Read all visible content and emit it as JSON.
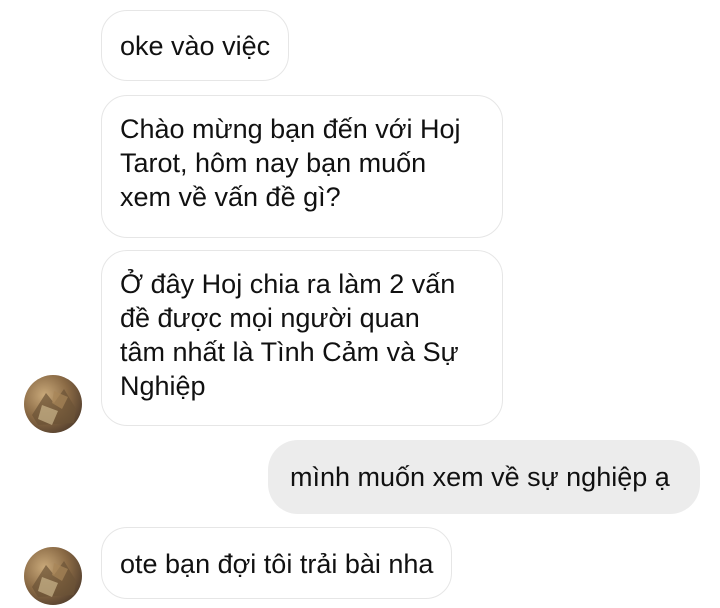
{
  "messages": [
    {
      "sender": "other",
      "text": "oke vào việc"
    },
    {
      "sender": "other",
      "text": "Chào mừng bạn đến với Hoj\nTarot, hôm nay bạn muốn\nxem về vấn đề gì?"
    },
    {
      "sender": "other",
      "text": "Ở đây Hoj chia ra làm 2 vấn\nđề được mọi người quan\ntâm nhất là Tình Cảm và Sự\nNghiệp"
    },
    {
      "sender": "me",
      "text": "mình muốn xem về sự nghiệp ạ"
    },
    {
      "sender": "other",
      "text": "ote bạn đợi tôi trải bài nha"
    }
  ],
  "colors": {
    "incoming_bubble": "#ffffff",
    "incoming_border": "#e6e6e6",
    "outgoing_bubble": "#ececec",
    "text": "#111111"
  }
}
